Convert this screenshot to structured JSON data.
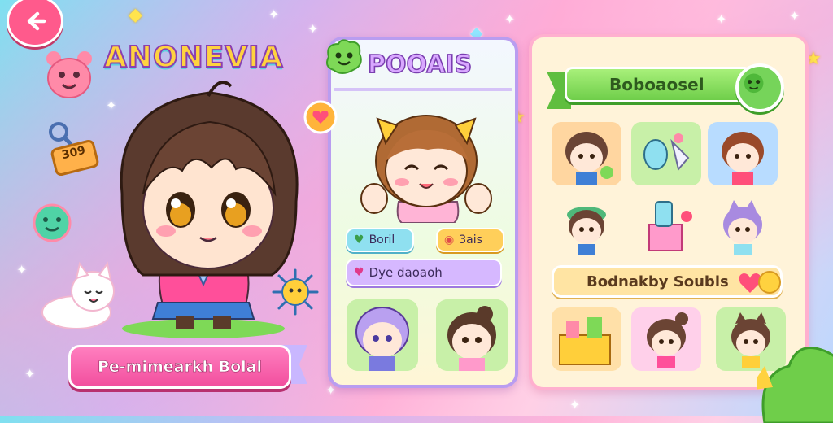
{
  "header": {
    "back_icon": "arrow-left-icon"
  },
  "profile": {
    "title": "ANONEVIA",
    "badge_text": "309",
    "name_banner": "Pe-mimearkh Bolal"
  },
  "middle_panel": {
    "title": "POOAIS",
    "stat1": {
      "icon": "heart-icon",
      "label": "Boril"
    },
    "stat2": {
      "icon": "bag-icon",
      "label": "3ais"
    },
    "wide_label": "Dye daoaoh"
  },
  "right_panel": {
    "header": "Boboaosel",
    "section_label": "Bodnakby Soubls"
  },
  "colors": {
    "accent_pink": "#f24f9e",
    "accent_green": "#6fce4a",
    "accent_purple": "#b99df0",
    "title_yellow": "#ffd23f"
  }
}
